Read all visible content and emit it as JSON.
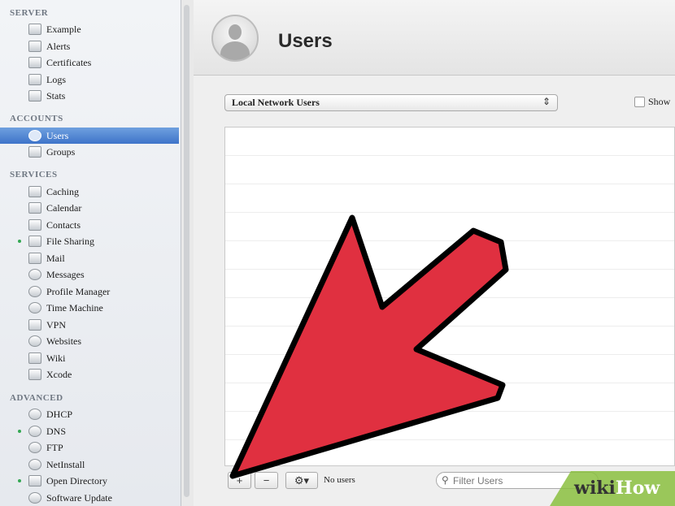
{
  "sidebar": {
    "sections": {
      "server": "SERVER",
      "accounts": "ACCOUNTS",
      "services": "SERVICES",
      "advanced": "ADVANCED"
    },
    "server_items": [
      "Example",
      "Alerts",
      "Certificates",
      "Logs",
      "Stats"
    ],
    "accounts_items": [
      "Users",
      "Groups"
    ],
    "services_items": [
      "Caching",
      "Calendar",
      "Contacts",
      "File Sharing",
      "Mail",
      "Messages",
      "Profile Manager",
      "Time Machine",
      "VPN",
      "Websites",
      "Wiki",
      "Xcode"
    ],
    "advanced_items": [
      "DHCP",
      "DNS",
      "FTP",
      "NetInstall",
      "Open Directory",
      "Software Update"
    ],
    "selected": "Users"
  },
  "header": {
    "title": "Users"
  },
  "main": {
    "user_source_select": "Local Network Users",
    "show_checkbox_label": "Show",
    "status": "No users",
    "filter_placeholder": "Filter Users",
    "add_label": "+",
    "remove_label": "−",
    "action_label": "⚙▾"
  },
  "icons": {
    "filter": "magnifier-icon",
    "overlay": "red-arrow-pointing-to-add-button"
  },
  "watermark": {
    "part1": "wiki",
    "part2": "How"
  },
  "colors": {
    "selection": "#4a80d0",
    "arrow_fill": "#e03040",
    "status_dot": "#34a853",
    "watermark_bg": "#8bbf3f"
  }
}
